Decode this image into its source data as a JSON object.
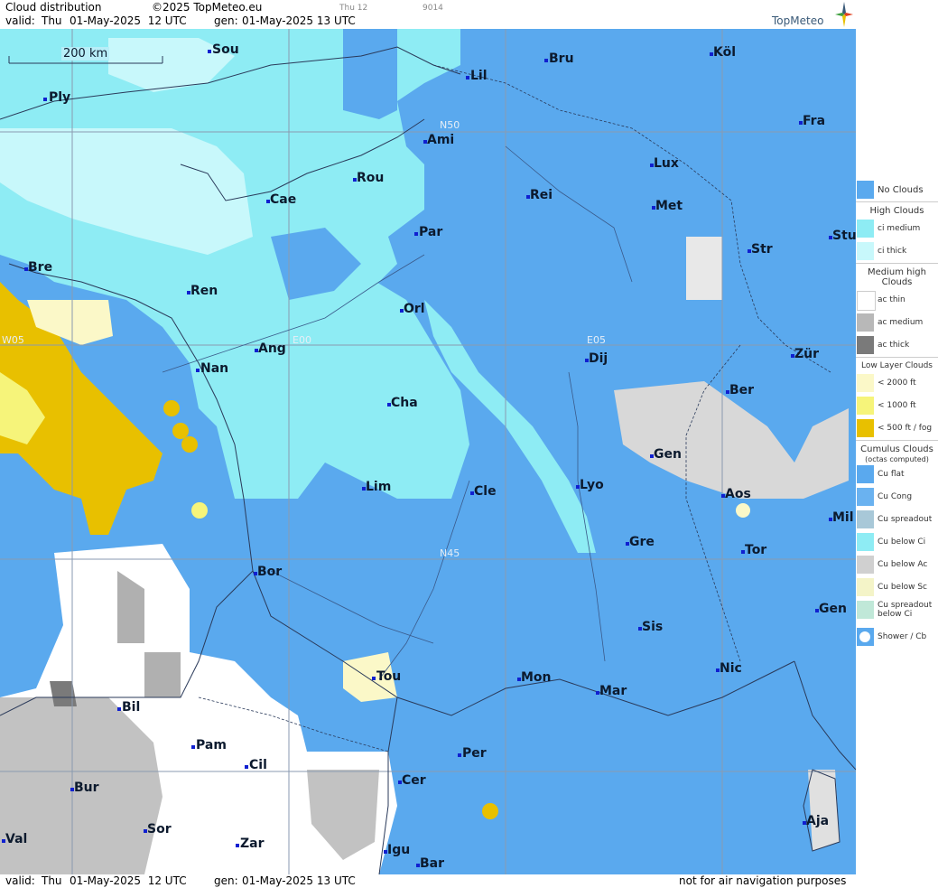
{
  "header": {
    "title": "Cloud distribution",
    "copyright": "©2025 TopMeteo.eu",
    "valid_label": "valid:",
    "valid_day": "Thu",
    "valid_time": "01-May-2025  12 UTC",
    "gen_label": "gen:",
    "gen_time": "01-May-2025 13 UTC",
    "small_code1": "Thu 12",
    "small_code2": "9014",
    "brand": "TopMeteo"
  },
  "map": {
    "scale_label": "200 km",
    "grid_labels": {
      "n50": "N50",
      "n45": "N45",
      "w05": "W05",
      "e00": "E00",
      "e05": "E05"
    },
    "cities": [
      {
        "name": "Sou"
      },
      {
        "name": "Ply"
      },
      {
        "name": "Lil"
      },
      {
        "name": "Bru"
      },
      {
        "name": "Köl"
      },
      {
        "name": "Ami"
      },
      {
        "name": "Fra"
      },
      {
        "name": "Rou"
      },
      {
        "name": "Lux"
      },
      {
        "name": "Cae"
      },
      {
        "name": "Rei"
      },
      {
        "name": "Met"
      },
      {
        "name": "Par"
      },
      {
        "name": "Bre"
      },
      {
        "name": "Str"
      },
      {
        "name": "Stu"
      },
      {
        "name": "Ren"
      },
      {
        "name": "Orl"
      },
      {
        "name": "Ang"
      },
      {
        "name": "Zür"
      },
      {
        "name": "Dij"
      },
      {
        "name": "Nan"
      },
      {
        "name": "Ber"
      },
      {
        "name": "Cha"
      },
      {
        "name": "Gen"
      },
      {
        "name": "Lim"
      },
      {
        "name": "Cle"
      },
      {
        "name": "Lyo"
      },
      {
        "name": "Aos"
      },
      {
        "name": "Mil"
      },
      {
        "name": "Gre"
      },
      {
        "name": "Tor"
      },
      {
        "name": "Bor"
      },
      {
        "name": "Gen"
      },
      {
        "name": "Sis"
      },
      {
        "name": "Nic"
      },
      {
        "name": "Tou"
      },
      {
        "name": "Mon"
      },
      {
        "name": "Mar"
      },
      {
        "name": "Bil"
      },
      {
        "name": "Pam"
      },
      {
        "name": "Per"
      },
      {
        "name": "Cil"
      },
      {
        "name": "Cer"
      },
      {
        "name": "Bur"
      },
      {
        "name": "Ajа"
      },
      {
        "name": "Sor"
      },
      {
        "name": "Val"
      },
      {
        "name": "Zar"
      },
      {
        "name": "Igu"
      },
      {
        "name": "Bar"
      }
    ]
  },
  "legend": {
    "no_clouds": "No Clouds",
    "high_clouds": "High Clouds",
    "ci_medium": "ci medium",
    "ci_thick": "ci thick",
    "medium_high": "Medium high Clouds",
    "ac_thin": "ac thin",
    "ac_medium": "ac medium",
    "ac_thick": "ac thick",
    "low_layer": "Low Layer Clouds",
    "lt2000": "< 2000 ft",
    "lt1000": "< 1000 ft",
    "lt500": "< 500 ft / fog",
    "cumulus": "Cumulus Clouds",
    "octas": "(octas computed)",
    "cu_flat": "Cu flat",
    "cu_cong": "Cu Cong",
    "cu_spreadout": "Cu spreadout",
    "cu_below_ci": "Cu below Ci",
    "cu_below_ac": "Cu below Ac",
    "cu_below_sc": "Cu below Sc",
    "cu_spreadout_below_ci": "Cu spreadout below Ci",
    "shower": "Shower / Cb"
  },
  "footer": {
    "valid_label": "valid:",
    "valid_day": "Thu",
    "valid_time": "01-May-2025  12 UTC",
    "gen_label": "gen:",
    "gen_time": "01-May-2025 13 UTC",
    "disclaimer": "not for air navigation purposes"
  },
  "colors": {
    "no_clouds": "#5aa9ee",
    "ci_medium": "#8eecf4",
    "ci_thick": "#c8f8fb",
    "ac_thin": "#ffffff",
    "ac_medium": "#b8b8b8",
    "ac_thick": "#7a7a7a",
    "low_2000": "#fbf8c8",
    "low_1000": "#f6f47a",
    "low_500": "#e8c000"
  }
}
